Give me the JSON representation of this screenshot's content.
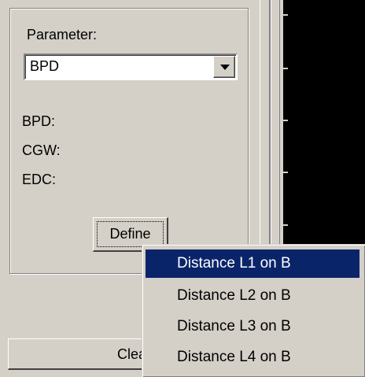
{
  "parameter": {
    "label": "Parameter:",
    "selected": "BPD"
  },
  "fields": [
    {
      "label": "BPD:"
    },
    {
      "label": "CGW:"
    },
    {
      "label": "EDC:"
    }
  ],
  "define_button": {
    "label": "Define"
  },
  "clear_button": {
    "label": "Clea"
  },
  "menu": {
    "items": [
      {
        "label": "Distance L1 on B",
        "selected": true
      },
      {
        "label": "Distance L2 on B",
        "selected": false
      },
      {
        "label": "Distance L3 on B",
        "selected": false
      },
      {
        "label": "Distance L4 on B",
        "selected": false
      }
    ]
  },
  "colors": {
    "face": "#d4d0c8",
    "highlight": "#0a246a",
    "display_bg": "#000000"
  }
}
